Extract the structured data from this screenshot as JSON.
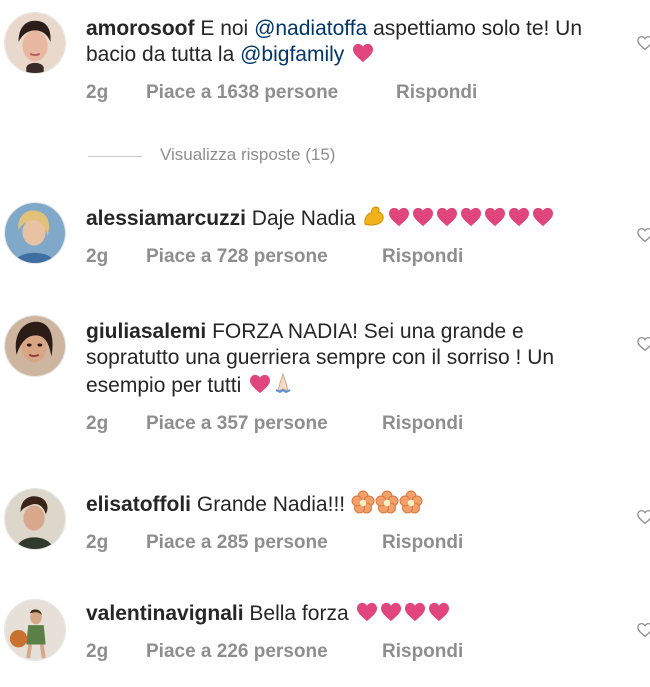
{
  "comments": [
    {
      "username": "amorosoof",
      "parts": [
        {
          "t": "E noi "
        },
        {
          "m": "@nadiatoffa"
        },
        {
          "t": " aspettiamo solo te! Un bacio da tutta la "
        },
        {
          "m": "@bigfamily"
        }
      ],
      "time": "2g",
      "likes": "Piace a 1638 persone",
      "reply": "Rispondi"
    },
    {
      "username": "alessiamarcuzzi",
      "text": "Daje Nadia",
      "time": "2g",
      "likes": "Piace a 728 persone",
      "reply": "Rispondi"
    },
    {
      "username": "giuliasalemi",
      "text": "FORZA NADIA! Sei una grande e sopratutto una guerriera  sempre con il sorriso ! Un esempio per tutti",
      "time": "2g",
      "likes": "Piace a 357 persone",
      "reply": "Rispondi"
    },
    {
      "username": "elisatoffoli",
      "text": "Grande Nadia!!!",
      "time": "2g",
      "likes": "Piace a 285 persone",
      "reply": "Rispondi"
    },
    {
      "username": "valentinavignali",
      "text": "Bella forza",
      "time": "2g",
      "likes": "Piace a 226 persone",
      "reply": "Rispondi"
    }
  ],
  "view_replies": "Visualizza risposte (15)",
  "icons": {
    "like": "heart-outline-icon",
    "emoji_heart": "pink-heart-emoji",
    "emoji_muscle": "flexed-biceps-emoji",
    "emoji_pray": "folded-hands-emoji",
    "emoji_flower": "blossom-emoji"
  },
  "colors": {
    "mention": "#003569",
    "meta": "#8e8e8e",
    "heart": "#e0457b"
  }
}
